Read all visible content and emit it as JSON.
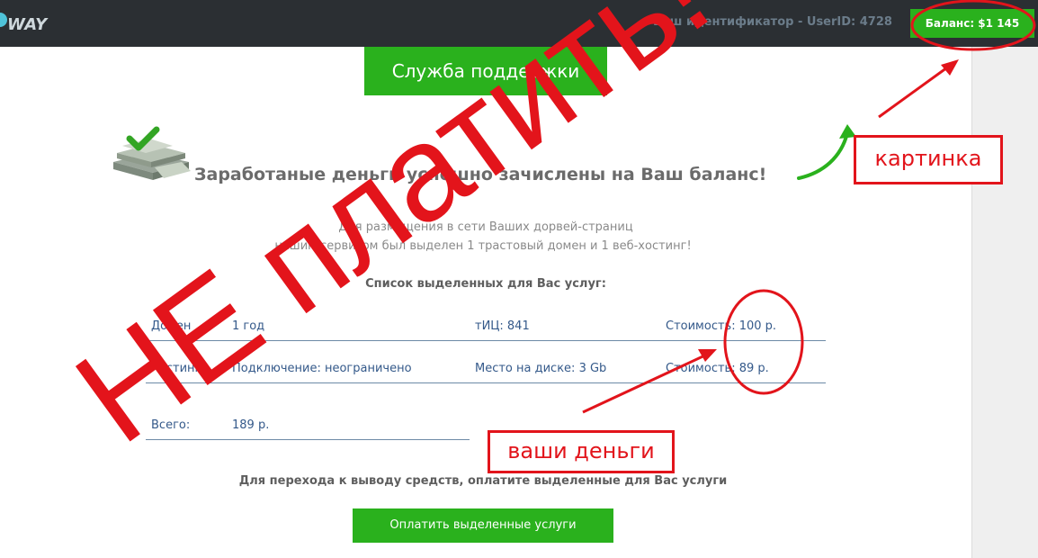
{
  "header": {
    "logo_text": "WAY",
    "user_id_label": "Ваш идентификатор - UserID: 4728",
    "balance_label": "Баланс: $1 145"
  },
  "support": {
    "label": "Служба поддержки"
  },
  "headline": "Заработаные деньги успешно зачислены на Ваш баланс!",
  "intro": {
    "line1": "Для размещения в сети Ваших дорвей-страниц",
    "line2": "нашим сервисом был выделен 1 трастовый домен и 1 веб-хостинг!"
  },
  "services": {
    "title": "Список выделенных для Вас услуг:",
    "rows": [
      {
        "name": "Домен",
        "term": "1 год",
        "param": "тИЦ: 841",
        "cost": "Стоимость: 100 р."
      },
      {
        "name": "Хостинг",
        "term": "Подключение: неограничено",
        "param": "Место на диске: 3 Gb",
        "cost": "Стоимость: 89 р."
      }
    ],
    "total_label": "Всего:",
    "total_value": "189 р."
  },
  "withdraw_text": "Для перехода к выводу средств, оплатите выделенные для Вас услуги",
  "pay_button": "Оплатить выделенные услуги",
  "annotations": {
    "stamp": "НЕ платить!",
    "picture_label": "картинка",
    "money_label": "ваши деньги",
    "color": "#e2141b"
  },
  "colors": {
    "header_bg": "#2b2f33",
    "accent_green": "#2ab11d",
    "table_text": "#34598a"
  }
}
